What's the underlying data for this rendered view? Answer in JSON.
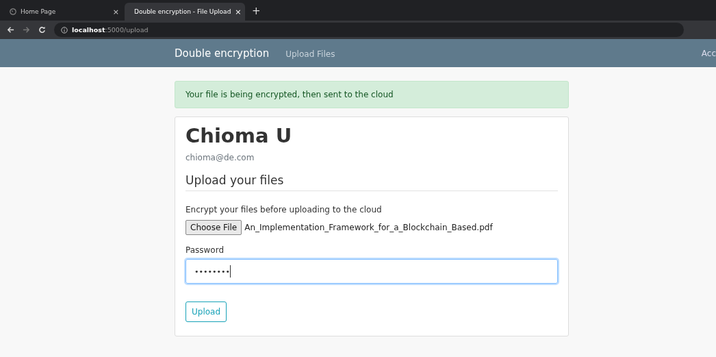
{
  "browser": {
    "tabs": [
      {
        "title": "Home Page",
        "close": "×",
        "selected": false
      },
      {
        "title": "Double encryption - File Upload",
        "close": "×",
        "selected": true
      }
    ],
    "new_tab": "+",
    "address": {
      "host": "localhost",
      "path": ":5000/upload"
    }
  },
  "navbar": {
    "brand": "Double encryption",
    "links": [
      "Upload Files"
    ],
    "right_link": "Acc"
  },
  "alert": "Your file is being encrypted, then sent to the cloud",
  "card": {
    "name": "Chioma U",
    "email": "chioma@de.com",
    "section_title": "Upload your files",
    "file_label": "Encrypt your files before uploading to the cloud",
    "file_button": "Choose File",
    "file_name": "An_Implementation_Framework_for_a_Blockchain_Based.pdf",
    "password_label": "Password",
    "password_value": "••••••••",
    "password_focused": true,
    "submit": "Upload"
  }
}
